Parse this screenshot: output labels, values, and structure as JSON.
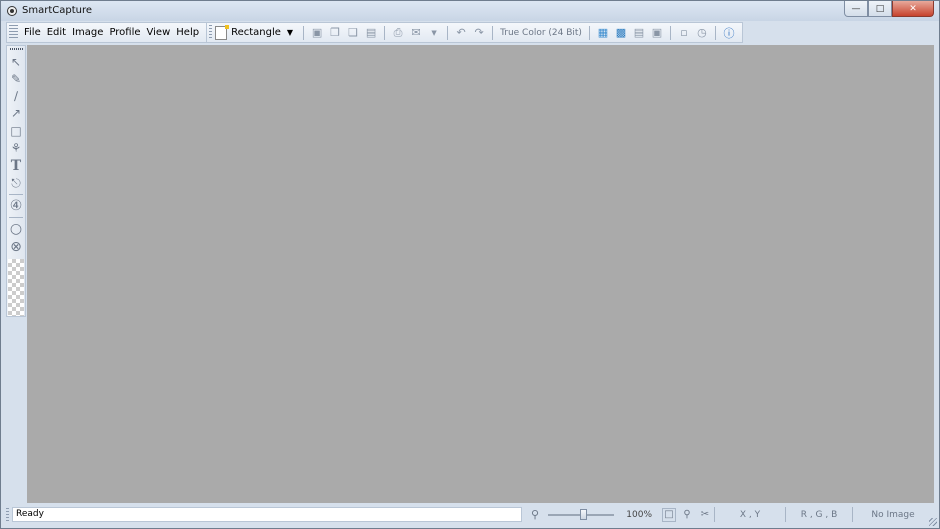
{
  "window": {
    "title": "SmartCapture"
  },
  "menu": [
    "File",
    "Edit",
    "Image",
    "Profile",
    "View",
    "Help"
  ],
  "capture": {
    "mode_label": "Rectangle"
  },
  "toolbar": {
    "color_mode": "True Color (24 Bit)"
  },
  "status": {
    "text": "Ready",
    "zoom": "100%",
    "zoom_level_fraction": 0.55,
    "coords": "X , Y",
    "rgb": "R , G , B",
    "image_info": "No Image"
  },
  "colors": {
    "canvas": "#aaaaaa",
    "chrome": "#d6e0ec",
    "close_button": "#c7432d"
  }
}
